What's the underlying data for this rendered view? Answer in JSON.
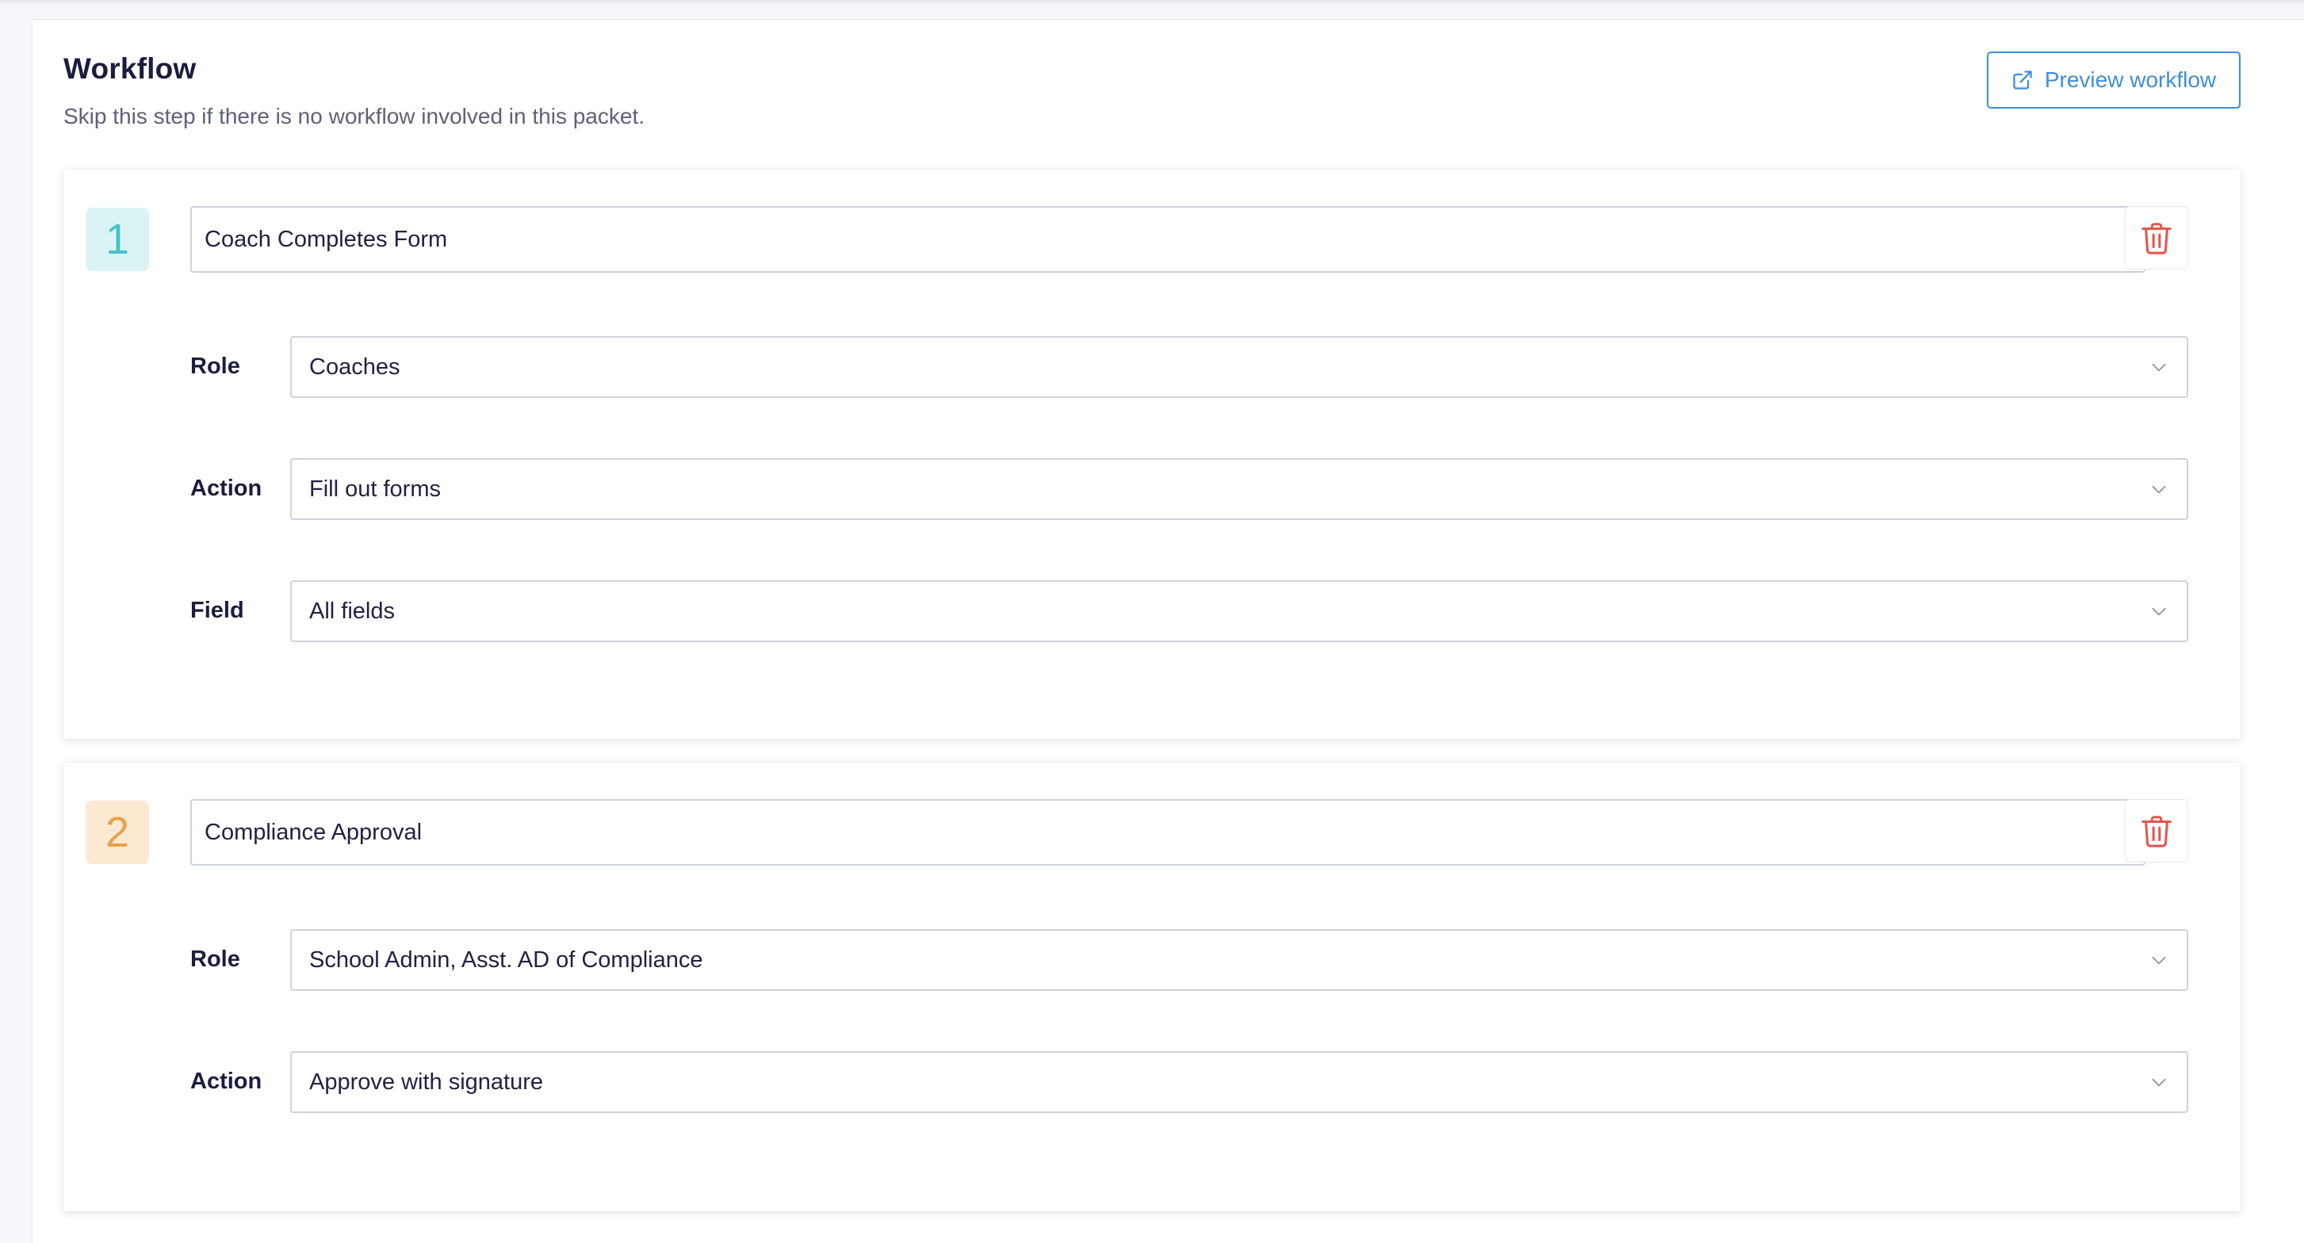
{
  "header": {
    "title": "Workflow",
    "subtitle": "Skip this step if there is no workflow involved in this packet.",
    "preview_button_label": "Preview workflow"
  },
  "colors": {
    "accent_blue": "#3d8fd8",
    "step1_badge": "#45c3c7",
    "step2_badge": "#e7a24a",
    "delete_red": "#e2574c"
  },
  "steps": [
    {
      "number": "1",
      "name": "Coach Completes Form",
      "fields": [
        {
          "label": "Role",
          "value": "Coaches"
        },
        {
          "label": "Action",
          "value": "Fill out forms"
        },
        {
          "label": "Field",
          "value": "All fields"
        }
      ]
    },
    {
      "number": "2",
      "name": "Compliance Approval",
      "fields": [
        {
          "label": "Role",
          "value": "School Admin, Asst. AD of Compliance"
        },
        {
          "label": "Action",
          "value": "Approve with signature"
        }
      ]
    }
  ],
  "icons": {
    "preview": "external-link-icon",
    "delete": "trash-icon",
    "dropdown": "chevron-down-icon"
  }
}
